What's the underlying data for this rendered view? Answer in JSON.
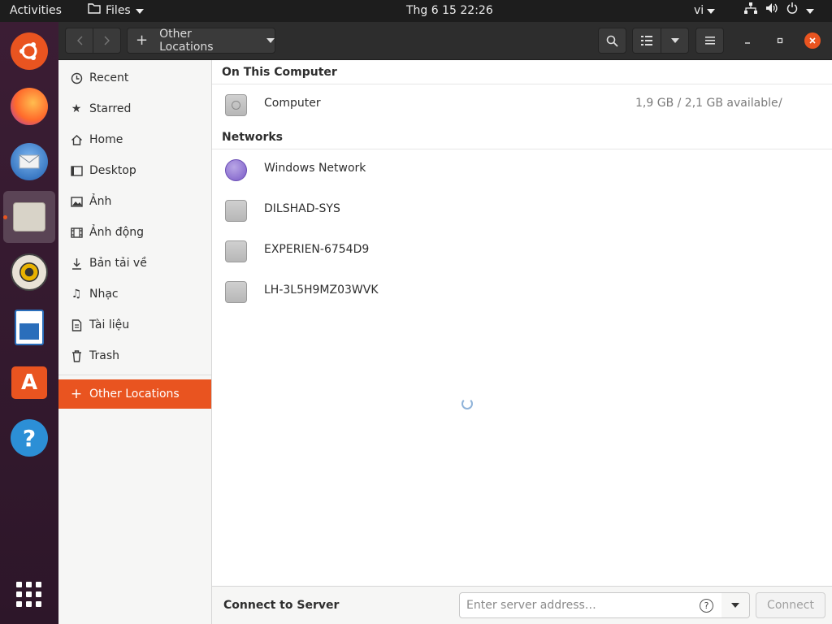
{
  "topbar": {
    "activities": "Activities",
    "app_menu": "Files",
    "clock": "Thg 6 15  22:26",
    "language": "vi"
  },
  "window": {
    "path_bar_label": "Other Locations"
  },
  "sidebar": {
    "items": [
      {
        "label": "Recent",
        "icon": "clock-icon"
      },
      {
        "label": "Starred",
        "icon": "star-icon"
      },
      {
        "label": "Home",
        "icon": "home-icon"
      },
      {
        "label": "Desktop",
        "icon": "desktop-icon"
      },
      {
        "label": "Ảnh",
        "icon": "picture-icon"
      },
      {
        "label": "Ảnh động",
        "icon": "video-icon"
      },
      {
        "label": "Bản tải về",
        "icon": "download-icon"
      },
      {
        "label": "Nhạc",
        "icon": "music-icon"
      },
      {
        "label": "Tài liệu",
        "icon": "document-icon"
      },
      {
        "label": "Trash",
        "icon": "trash-icon"
      }
    ],
    "other_locations": "Other Locations"
  },
  "main": {
    "on_this_computer": "On This Computer",
    "computer": {
      "name": "Computer",
      "usage": "1,9 GB / 2,1 GB available",
      "mount": "/"
    },
    "networks_title": "Networks",
    "networks": [
      {
        "name": "Windows Network"
      },
      {
        "name": "DILSHAD-SYS"
      },
      {
        "name": "EXPERIEN-6754D9"
      },
      {
        "name": "LH-3L5H9MZ03WVK"
      }
    ]
  },
  "connect": {
    "label": "Connect to Server",
    "placeholder": "Enter server address…",
    "button": "Connect"
  },
  "colors": {
    "accent": "#e95420",
    "headerbar": "#2d2d2d",
    "topbar": "#1d1d1d"
  }
}
